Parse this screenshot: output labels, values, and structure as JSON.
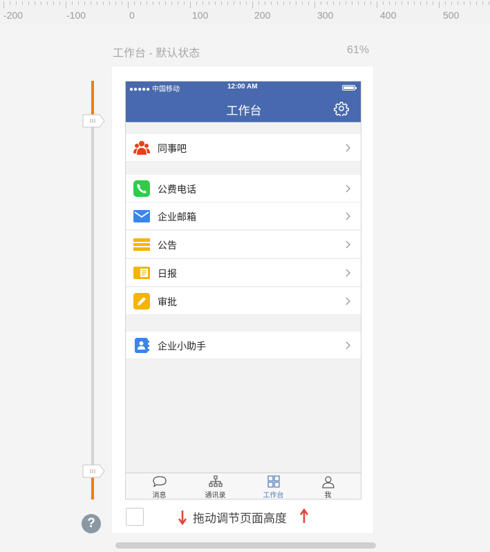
{
  "ruler": {
    "labels": [
      "-200",
      "-100",
      "0",
      "100",
      "200",
      "300",
      "400",
      "500"
    ]
  },
  "caption": {
    "title": "工作台 - 默认状态",
    "zoom": "61%"
  },
  "status_bar": {
    "carrier": "●●●●● 中国移动",
    "time": "12:00 AM"
  },
  "nav": {
    "title": "工作台",
    "settings_icon": "gear-icon"
  },
  "groups": {
    "g1": [
      {
        "label": "同事吧",
        "icon": "people-icon",
        "color": "#e8401c"
      }
    ],
    "g2": [
      {
        "label": "公费电话",
        "icon": "phone-icon",
        "color": "#2fcc4c"
      },
      {
        "label": "企业邮箱",
        "icon": "mail-icon",
        "color": "#3a86e6"
      },
      {
        "label": "公告",
        "icon": "announcement-icon",
        "color": "#f4b400"
      },
      {
        "label": "日报",
        "icon": "daily-report-icon",
        "color": "#f4b400"
      },
      {
        "label": "审批",
        "icon": "approval-pencil-icon",
        "color": "#f4b400"
      }
    ],
    "g3": [
      {
        "label": "企业小助手",
        "icon": "contact-book-icon",
        "color": "#3a86e6"
      }
    ]
  },
  "tabs": [
    {
      "label": "消息",
      "icon": "chat-bubble-icon",
      "active": false
    },
    {
      "label": "通讯录",
      "icon": "org-chart-icon",
      "active": false
    },
    {
      "label": "工作台",
      "icon": "grid-icon",
      "active": true
    },
    {
      "label": "我",
      "icon": "person-icon",
      "active": false
    }
  ],
  "footer": {
    "text": "拖动调节页面高度",
    "help": "?"
  },
  "colors": {
    "brand": "#4869ad",
    "accent": "#f07c17",
    "arrow": "#e0473a",
    "active_tab": "#4c78b9"
  }
}
